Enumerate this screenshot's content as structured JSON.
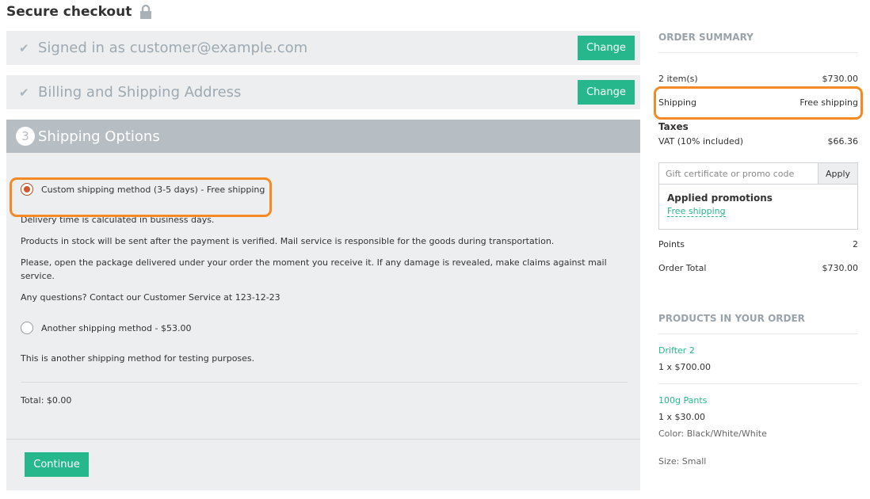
{
  "page": {
    "title": "Secure checkout"
  },
  "steps": {
    "signed_in": {
      "label": "Signed in as customer@example.com",
      "change_label": "Change"
    },
    "address": {
      "label": "Billing and Shipping Address",
      "change_label": "Change"
    },
    "shipping": {
      "number": "3",
      "title": "Shipping Options",
      "options": [
        {
          "label": "Custom shipping method (3-5 days) - Free shipping",
          "selected": true,
          "descriptions": [
            "Delivery time is calculated in business days.",
            "Products in stock will be sent after the payment is verified. Mail service is responsible for the goods during transportation.",
            "Please, open the package delivered under your order the moment you receive it. If any damage is revealed, make claims against mail service.",
            "Any questions? Contact our Customer Service at 123-12-23"
          ]
        },
        {
          "label": "Another shipping method - $53.00",
          "selected": false,
          "descriptions": [
            "This is another shipping method for testing purposes."
          ]
        }
      ],
      "total": "Total: $0.00",
      "continue_label": "Continue"
    }
  },
  "summary": {
    "title": "ORDER SUMMARY",
    "items_label": "2 item(s)",
    "items_value": "$730.00",
    "shipping_label": "Shipping",
    "shipping_value": "Free shipping",
    "taxes_title": "Taxes",
    "vat_label": "VAT (10% included)",
    "vat_value": "$66.36",
    "promo_placeholder": "Gift certificate or promo code",
    "apply_label": "Apply",
    "applied_title": "Applied promotions",
    "applied_promo": "Free shipping",
    "points_label": "Points",
    "points_value": "2",
    "total_label": "Order Total",
    "total_value": "$730.00"
  },
  "products": {
    "title": "PRODUCTS IN YOUR ORDER",
    "items": [
      {
        "name": "Drifter 2",
        "qty_price": "1 x $700.00"
      },
      {
        "name": "100g Pants",
        "qty_price": "1 x $30.00",
        "color": "Color: Black/White/White",
        "size": "Size: Small"
      }
    ]
  },
  "colors": {
    "accent": "#26b78c",
    "highlight": "#f58a22",
    "step_active": "#b6bec4",
    "panel_bg": "#eceeef"
  }
}
